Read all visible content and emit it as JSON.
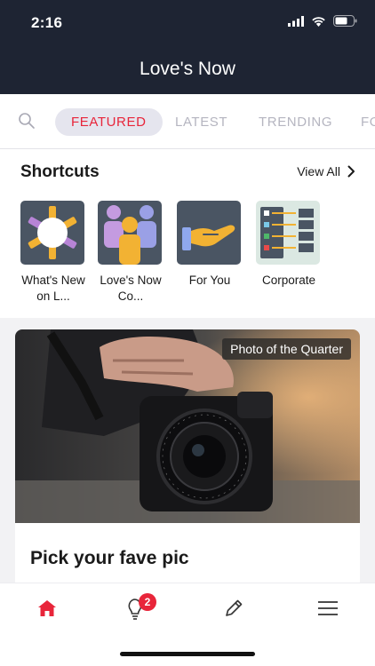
{
  "status_bar": {
    "time": "2:16"
  },
  "header": {
    "title": "Love's Now"
  },
  "tabs": [
    {
      "label": "FEATURED",
      "active": true
    },
    {
      "label": "LATEST",
      "active": false
    },
    {
      "label": "TRENDING",
      "active": false
    },
    {
      "label": "FO",
      "active": false
    }
  ],
  "shortcuts": {
    "title": "Shortcuts",
    "view_all": "View All",
    "items": [
      {
        "label": "What's New on L...",
        "icon": "sun-flower-icon"
      },
      {
        "label": "Love's Now Co...",
        "icon": "people-group-icon"
      },
      {
        "label": "For You",
        "icon": "hand-offer-icon"
      },
      {
        "label": "Corporate",
        "icon": "org-chart-icon"
      }
    ]
  },
  "feature_card": {
    "badge": "Photo of the Quarter",
    "title": "Pick your fave pic",
    "image": "hands-holding-camera-photo"
  },
  "bottom_nav": {
    "items": [
      "home-icon",
      "lightbulb-icon",
      "pencil-icon",
      "menu-icon"
    ],
    "notification_count": "2"
  },
  "colors": {
    "header": "#1e2433",
    "accent": "#e8253a",
    "tab_inactive": "#b5b5c0"
  }
}
